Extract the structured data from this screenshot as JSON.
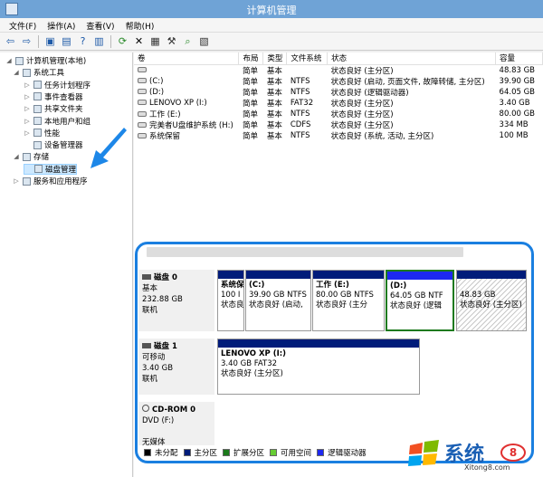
{
  "window": {
    "title": "计算机管理"
  },
  "menu": [
    "文件(F)",
    "操作(A)",
    "查看(V)",
    "帮助(H)"
  ],
  "toolbar": [
    "back-icon",
    "forward-icon",
    "up-folder-icon",
    "properties-icon",
    "help-icon",
    "show-hide-icon",
    "refresh-icon",
    "close-icon",
    "disk-icon",
    "tools-icon",
    "search-icon",
    "settings-icon"
  ],
  "tree": [
    {
      "label": "计算机管理(本地)",
      "level": 0,
      "icon": "computer-icon",
      "exp": "◢"
    },
    {
      "label": "系统工具",
      "level": 1,
      "icon": "tools-icon",
      "exp": "◢"
    },
    {
      "label": "任务计划程序",
      "level": 2,
      "icon": "scheduler-icon",
      "exp": "▷"
    },
    {
      "label": "事件查看器",
      "level": 2,
      "icon": "event-viewer-icon",
      "exp": "▷"
    },
    {
      "label": "共享文件夹",
      "level": 2,
      "icon": "shared-folder-icon",
      "exp": "▷"
    },
    {
      "label": "本地用户和组",
      "level": 2,
      "icon": "users-icon",
      "exp": "▷"
    },
    {
      "label": "性能",
      "level": 2,
      "icon": "performance-icon",
      "exp": "▷"
    },
    {
      "label": "设备管理器",
      "level": 2,
      "icon": "device-manager-icon",
      "exp": ""
    },
    {
      "label": "存储",
      "level": 1,
      "icon": "storage-icon",
      "exp": "◢"
    },
    {
      "label": "磁盘管理",
      "level": 2,
      "icon": "disk-management-icon",
      "exp": "",
      "selected": true
    },
    {
      "label": "服务和应用程序",
      "level": 1,
      "icon": "services-icon",
      "exp": "▷"
    }
  ],
  "volumes": {
    "headers": [
      "卷",
      "布局",
      "类型",
      "文件系统",
      "状态",
      "容量"
    ],
    "rows": [
      [
        "",
        "简单",
        "基本",
        "",
        "状态良好 (主分区)",
        "48.83 GB"
      ],
      [
        "(C:)",
        "简单",
        "基本",
        "NTFS",
        "状态良好 (启动, 页面文件, 故障转储, 主分区)",
        "39.90 GB"
      ],
      [
        "(D:)",
        "简单",
        "基本",
        "NTFS",
        "状态良好 (逻辑驱动器)",
        "64.05 GB"
      ],
      [
        "LENOVO XP (I:)",
        "简单",
        "基本",
        "FAT32",
        "状态良好 (主分区)",
        "3.40 GB"
      ],
      [
        "工作 (E:)",
        "简单",
        "基本",
        "NTFS",
        "状态良好 (主分区)",
        "80.00 GB"
      ],
      [
        "完美者U盘维护系统 (H:)",
        "简单",
        "基本",
        "CDFS",
        "状态良好 (主分区)",
        "334 MB"
      ],
      [
        "系统保留",
        "简单",
        "基本",
        "NTFS",
        "状态良好 (系统, 活动, 主分区)",
        "100 MB"
      ]
    ]
  },
  "disks": [
    {
      "name": "磁盘 0",
      "type": "基本",
      "size": "232.88 GB",
      "status": "联机"
    },
    {
      "name": "磁盘 1",
      "type": "可移动",
      "size": "3.40 GB",
      "status": "联机"
    },
    {
      "name": "CD-ROM 0",
      "type": "DVD (F:)",
      "size": "",
      "status": "无媒体"
    }
  ],
  "partitions0": [
    {
      "l1": "系统保",
      "l2": "100 I",
      "l3": "状态良"
    },
    {
      "l1": "(C:)",
      "l2": "39.90 GB NTFS",
      "l3": "状态良好 (启动,"
    },
    {
      "l1": "工作 (E:)",
      "l2": "80.00 GB NTFS",
      "l3": "状态良好 (主分"
    },
    {
      "l1": "(D:)",
      "l2": "64.05 GB NTF",
      "l3": "状态良好 (逻辑"
    },
    {
      "l1": "",
      "l2": "48.83 GB",
      "l3": "状态良好 (主分区)"
    }
  ],
  "partition1": {
    "l1": "LENOVO XP  (I:)",
    "l2": "3.40 GB FAT32",
    "l3": "状态良好 (主分区)"
  },
  "legend": [
    {
      "label": "未分配",
      "color": "#000000"
    },
    {
      "label": "主分区",
      "color": "#001c7a"
    },
    {
      "label": "扩展分区",
      "color": "#1b7a1b"
    },
    {
      "label": "可用空间",
      "color": "#66cc33"
    },
    {
      "label": "逻辑驱动器",
      "color": "#1d28f0"
    }
  ],
  "watermark": {
    "brand": "系统",
    "url": "Xitong8.com",
    "circle": "8"
  }
}
